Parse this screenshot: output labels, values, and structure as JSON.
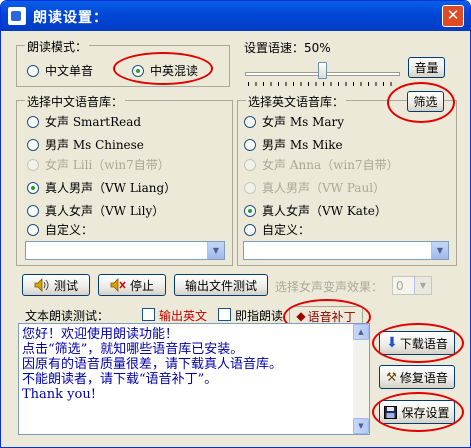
{
  "window": {
    "title": "朗读设置：",
    "close": "✕"
  },
  "read_mode": {
    "legend": "朗读模式：",
    "options": [
      "中文单音",
      "中英混读"
    ],
    "selected_index": 1
  },
  "speed": {
    "label": "设置语速：50%",
    "value_percent": 50,
    "volume_button": "音量"
  },
  "chinese_voices": {
    "legend": "选择中文语音库：",
    "options": [
      {
        "label": "女声 SmartRead",
        "enabled": true
      },
      {
        "label": "男声 Ms Chinese",
        "enabled": true
      },
      {
        "label": "女声 Lili（win7自带）",
        "enabled": false
      },
      {
        "label": "真人男声（VW Liang）",
        "enabled": true
      },
      {
        "label": "真人女声（VW Lily）",
        "enabled": true
      },
      {
        "label": "自定义：",
        "enabled": true
      }
    ],
    "selected_index": 3,
    "custom_value": ""
  },
  "english_voices": {
    "legend": "选择英文语音库：",
    "filter_button": "筛选",
    "options": [
      {
        "label": "女声 Ms Mary",
        "enabled": true
      },
      {
        "label": "男声 Ms Mike",
        "enabled": true
      },
      {
        "label": "女声 Anna（win7自带）",
        "enabled": false
      },
      {
        "label": "真人男声（VW Paul）",
        "enabled": false
      },
      {
        "label": "真人女声（VW Kate）",
        "enabled": true
      },
      {
        "label": "自定义：",
        "enabled": true
      }
    ],
    "selected_index": 4,
    "custom_value": ""
  },
  "actions": {
    "test": "测试",
    "stop": "停止",
    "export_test": "输出文件测试",
    "female_effect_label": "选择女声变声效果：",
    "female_effect_value": "0"
  },
  "text_test": {
    "label": "文本朗读测试：",
    "export_english": "输出英文",
    "instant_read": "即指朗读",
    "voice_patch": "语音补丁",
    "lines": [
      "您好！欢迎使用朗读功能！",
      "点击“筛选”，就知哪些语音库已安装。",
      "因原有的语音质量很差，请下载真人语音库。",
      "不能朗读者，请下载“语音补丁”。",
      "Thank you!"
    ]
  },
  "side_buttons": {
    "download": "下载语音",
    "repair": "修复语音",
    "save": "保存设置"
  },
  "colors": {
    "titlebar": "#0047d6",
    "window_bg": "#ece9d8",
    "annotation_red": "#e10000",
    "text_blue": "#0000a8",
    "export_red": "#c00000"
  }
}
